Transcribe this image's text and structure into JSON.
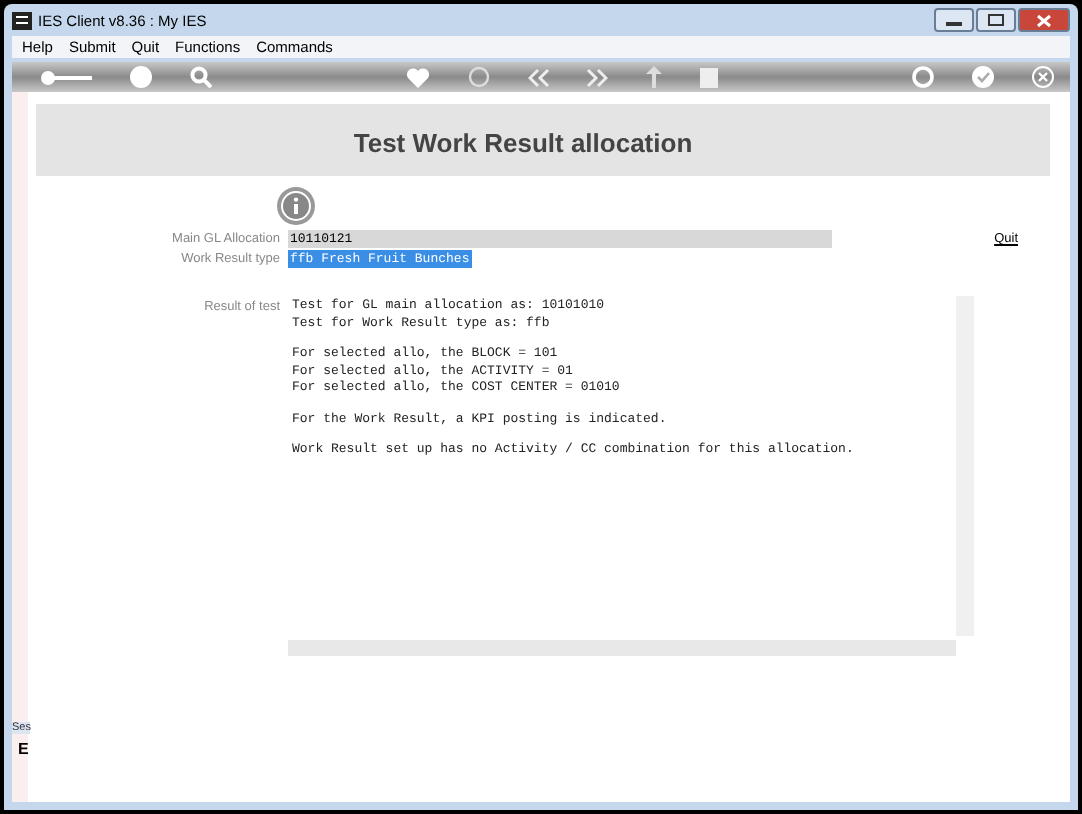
{
  "window": {
    "title": "IES Client v8.36 : My IES"
  },
  "menu": [
    "Help",
    "Submit",
    "Quit",
    "Functions",
    "Commands"
  ],
  "page": {
    "title": "Test Work Result allocation"
  },
  "fields": [
    {
      "label": "Main GL Allocation",
      "value": "10110121",
      "selected": false
    },
    {
      "label": "Work Result type",
      "value": "ffb Fresh Fruit Bunches",
      "selected": true
    }
  ],
  "quit_link": "Quit",
  "result": {
    "label": "Result of test",
    "paragraphs": [
      [
        "Test for GL main allocation as: 10101010",
        "Test for Work Result type as: ffb"
      ],
      [
        "For selected allo, the BLOCK = 101",
        "For selected allo, the ACTIVITY = 01",
        "For selected allo, the COST CENTER = 01010"
      ],
      [
        "For the Work Result, a KPI posting is indicated."
      ],
      [
        "Work Result set up has no Activity / CC combination for this allocation."
      ]
    ]
  },
  "side_strip": {
    "tab": "Ses",
    "letter": "E"
  }
}
